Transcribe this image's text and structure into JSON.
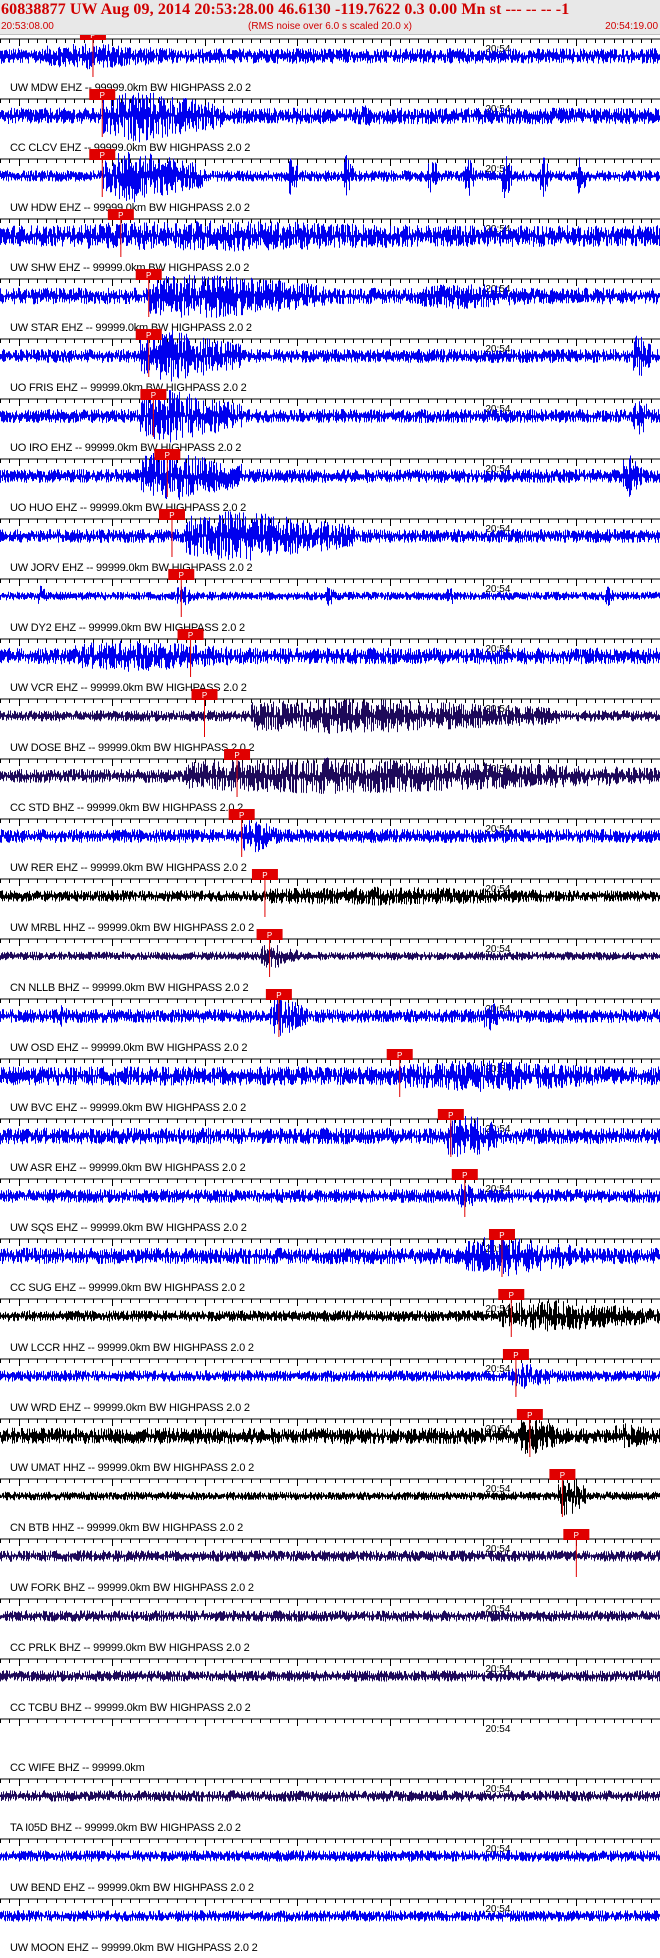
{
  "header": {
    "title": "60838877 UW Aug 09, 2014 20:53:28.00   46.6130 -119.7622  0.3 0.00 Mn st --- -- --  -1",
    "start_time": "20:53:08.00",
    "scale_note": "(RMS noise over 6.0 s scaled 20.0 x)",
    "end_time": "20:54:19.00"
  },
  "colors": {
    "trace_blue": "#0000ee",
    "trace_purple": "#1e0a5a",
    "trace_black": "#000000",
    "pick_red": "#e00000",
    "header_bg": "#e8e8e8"
  },
  "chart_data": {
    "type": "line",
    "title": "60838877 UW Aug 09, 2014 20:53:28.00   46.6130 -119.7622  0.3 0.00 Mn st --- -- --  -1",
    "x_axis": {
      "start": "20:53:08.00",
      "end": "20:54:19.00",
      "range_s": [
        0,
        71
      ],
      "tick_label": "20:54",
      "tick_label_time_s": 52
    },
    "grid": false,
    "pick_label": "P",
    "traces": [
      {
        "label": "UW MDW EHZ -- 99999.0km BW  HIGHPASS  2.0  2",
        "color": "blue",
        "pick_s": 10.0,
        "amplitude": 0.28,
        "bursts": [
          [
            5,
            20,
            0.5
          ]
        ]
      },
      {
        "label": "CC CLCV EHZ -- 99999.0km BW  HIGHPASS  2.0  2",
        "color": "blue",
        "pick_s": 11.0,
        "amplitude": 0.3,
        "bursts": [
          [
            11,
            24,
            1.0
          ],
          [
            38,
            42,
            0.4
          ]
        ]
      },
      {
        "label": "UW HDW EHZ -- 99999.0km BW  HIGHPASS  2.0  2",
        "color": "blue",
        "pick_s": 11.0,
        "amplitude": 0.2,
        "bursts": [
          [
            11,
            22,
            1.0
          ],
          [
            31,
            32,
            0.9
          ],
          [
            37,
            38,
            0.9
          ],
          [
            46,
            47,
            0.9
          ],
          [
            50,
            51,
            0.9
          ],
          [
            54,
            55,
            0.9
          ],
          [
            58,
            59,
            0.9
          ],
          [
            62,
            63,
            0.9
          ]
        ]
      },
      {
        "label": "UW SHW EHZ -- 99999.0km BW  HIGHPASS  2.0  2",
        "color": "blue",
        "pick_s": 13.0,
        "amplitude": 0.4,
        "bursts": [
          [
            8,
            60,
            0.6
          ]
        ]
      },
      {
        "label": "UW STAR EHZ -- 99999.0km BW  HIGHPASS  2.0  2",
        "color": "blue",
        "pick_s": 16.0,
        "amplitude": 0.3,
        "bursts": [
          [
            16,
            35,
            0.9
          ],
          [
            45,
            60,
            0.5
          ]
        ]
      },
      {
        "label": "UO FRIS EHZ -- 99999.0km BW  HIGHPASS  2.0  2",
        "color": "blue",
        "pick_s": 16.0,
        "amplitude": 0.25,
        "bursts": [
          [
            15,
            26,
            1.0
          ],
          [
            68,
            70,
            0.9
          ]
        ]
      },
      {
        "label": "UO IRO EHZ -- 99999.0km BW  HIGHPASS  2.0  2",
        "color": "blue",
        "pick_s": 16.5,
        "amplitude": 0.25,
        "bursts": [
          [
            15,
            26,
            1.0
          ],
          [
            68,
            70,
            0.8
          ]
        ]
      },
      {
        "label": "UO HUO EHZ -- 99999.0km BW  HIGHPASS  2.0  2",
        "color": "blue",
        "pick_s": 18.0,
        "amplitude": 0.25,
        "bursts": [
          [
            15,
            26,
            1.0
          ],
          [
            67,
            69,
            0.9
          ]
        ]
      },
      {
        "label": "UW JORV EHZ -- 99999.0km BW  HIGHPASS  2.0  2",
        "color": "blue",
        "pick_s": 18.5,
        "amplitude": 0.25,
        "bursts": [
          [
            20,
            38,
            1.0
          ]
        ]
      },
      {
        "label": "UW DY2 EHZ -- 99999.0km BW  HIGHPASS  2.0  2",
        "color": "blue",
        "pick_s": 19.5,
        "amplitude": 0.15,
        "bursts": [
          [
            4,
            5,
            0.4
          ],
          [
            19,
            21,
            0.4
          ],
          [
            35,
            36,
            0.4
          ],
          [
            48,
            49,
            0.4
          ],
          [
            65,
            66,
            0.4
          ]
        ]
      },
      {
        "label": "UW VCR EHZ -- 99999.0km BW  HIGHPASS  2.0  2",
        "color": "blue",
        "pick_s": 20.5,
        "amplitude": 0.3,
        "bursts": [
          [
            8,
            28,
            0.6
          ]
        ]
      },
      {
        "label": "UW DOSE BHZ -- 99999.0km BW  HIGHPASS  2.0  2",
        "color": "purple",
        "pick_s": 22.0,
        "amplitude": 0.2,
        "bursts": [
          [
            27,
            60,
            0.7
          ]
        ]
      },
      {
        "label": "CC STD BHZ -- 99999.0km BW  HIGHPASS  2.0  2",
        "color": "purple",
        "pick_s": 25.5,
        "amplitude": 0.25,
        "bursts": [
          [
            20,
            71,
            0.7
          ]
        ]
      },
      {
        "label": "UW RER EHZ -- 99999.0km BW  HIGHPASS  2.0  2",
        "color": "blue",
        "pick_s": 26.0,
        "amplitude": 0.25,
        "bursts": [
          [
            26,
            30,
            0.7
          ]
        ]
      },
      {
        "label": "UW MRBL HHZ -- 99999.0km BW  HIGHPASS  2.0  2",
        "color": "black",
        "pick_s": 28.5,
        "amplitude": 0.2,
        "bursts": [
          [
            28,
            70,
            0.35
          ]
        ]
      },
      {
        "label": "CN NLLB BHZ -- 99999.0km BW  HIGHPASS  2.0  2",
        "color": "purple",
        "pick_s": 29.0,
        "amplitude": 0.15,
        "bursts": [
          [
            28,
            32,
            0.5
          ]
        ]
      },
      {
        "label": "UW OSD EHZ -- 99999.0km BW  HIGHPASS  2.0  2",
        "color": "blue",
        "pick_s": 30.0,
        "amplitude": 0.25,
        "bursts": [
          [
            29,
            33,
            0.8
          ],
          [
            52,
            54,
            0.6
          ],
          [
            6,
            8,
            0.4
          ]
        ]
      },
      {
        "label": "UW BVC EHZ -- 99999.0km BW  HIGHPASS  2.0  2",
        "color": "blue",
        "pick_s": 43.0,
        "amplitude": 0.35,
        "bursts": [
          [
            43,
            71,
            0.6
          ]
        ]
      },
      {
        "label": "UW ASR EHZ -- 99999.0km BW  HIGHPASS  2.0  2",
        "color": "blue",
        "pick_s": 48.5,
        "amplitude": 0.3,
        "bursts": [
          [
            48,
            54,
            0.9
          ]
        ]
      },
      {
        "label": "UW SQS EHZ -- 99999.0km BW  HIGHPASS  2.0  2",
        "color": "blue",
        "pick_s": 50.0,
        "amplitude": 0.25,
        "bursts": [
          [
            49,
            52,
            0.5
          ]
        ]
      },
      {
        "label": "CC SUG EHZ -- 99999.0km BW  HIGHPASS  2.0  2",
        "color": "blue",
        "pick_s": 54.0,
        "amplitude": 0.3,
        "bursts": [
          [
            50,
            63,
            0.8
          ]
        ]
      },
      {
        "label": "UW LCCR HHZ -- 99999.0km BW  HIGHPASS  2.0  2",
        "color": "black",
        "pick_s": 55.0,
        "amplitude": 0.2,
        "bursts": [
          [
            54,
            71,
            0.6
          ]
        ]
      },
      {
        "label": "UW WRD EHZ -- 99999.0km BW  HIGHPASS  2.0  2",
        "color": "blue",
        "pick_s": 55.5,
        "amplitude": 0.2,
        "bursts": [
          [
            55,
            60,
            0.5
          ]
        ]
      },
      {
        "label": "UW UMAT HHZ -- 99999.0km BW  HIGHPASS  2.0  2",
        "color": "black",
        "pick_s": 57.0,
        "amplitude": 0.3,
        "bursts": [
          [
            56,
            60,
            0.8
          ],
          [
            66,
            71,
            0.5
          ]
        ]
      },
      {
        "label": "CN BTB HHZ -- 99999.0km BW  HIGHPASS  2.0  2",
        "color": "black",
        "pick_s": 60.5,
        "amplitude": 0.15,
        "bursts": [
          [
            60,
            63,
            0.8
          ]
        ]
      },
      {
        "label": "UW FORK BHZ -- 99999.0km BW  HIGHPASS  2.0  2",
        "color": "purple",
        "pick_s": 62.0,
        "amplitude": 0.2,
        "bursts": []
      },
      {
        "label": "CC PRLK BHZ -- 99999.0km BW  HIGHPASS  2.0  2",
        "color": "purple",
        "pick_s": null,
        "amplitude": 0.2,
        "bursts": []
      },
      {
        "label": "CC TCBU BHZ -- 99999.0km BW  HIGHPASS  2.0  2",
        "color": "purple",
        "pick_s": null,
        "amplitude": 0.2,
        "bursts": []
      },
      {
        "label": "CC WIFE BHZ -- 99999.0km",
        "color": "purple",
        "pick_s": null,
        "amplitude": 0.0,
        "bursts": []
      },
      {
        "label": "TA I05D BHZ -- 99999.0km BW  HIGHPASS  2.0  2",
        "color": "purple",
        "pick_s": null,
        "amplitude": 0.2,
        "bursts": []
      },
      {
        "label": "UW BEND EHZ -- 99999.0km BW  HIGHPASS  2.0  2",
        "color": "blue",
        "pick_s": null,
        "amplitude": 0.2,
        "bursts": []
      },
      {
        "label": "UW MOON EHZ -- 99999.0km BW  HIGHPASS  2.0  2",
        "color": "blue",
        "pick_s": null,
        "amplitude": 0.2,
        "bursts": []
      }
    ]
  }
}
